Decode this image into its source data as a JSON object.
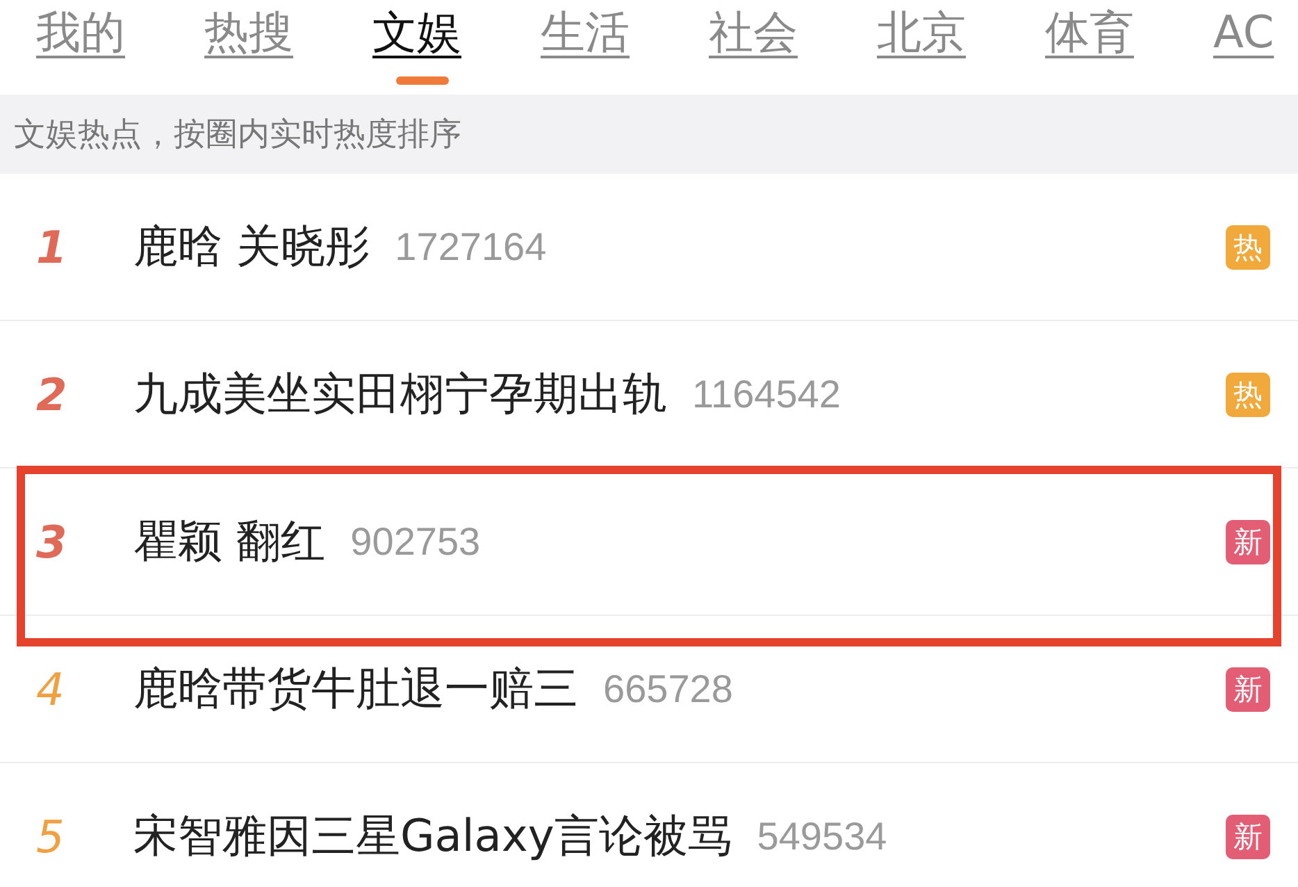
{
  "tabs": [
    {
      "label": "我的",
      "selected": false
    },
    {
      "label": "热搜",
      "selected": false
    },
    {
      "label": "文娱",
      "selected": true
    },
    {
      "label": "生活",
      "selected": false
    },
    {
      "label": "社会",
      "selected": false
    },
    {
      "label": "北京",
      "selected": false
    },
    {
      "label": "体育",
      "selected": false
    },
    {
      "label": "AC",
      "selected": false
    }
  ],
  "subtitle": "文娱热点，按圈内实时热度排序",
  "items": [
    {
      "rank": "1",
      "title": "鹿晗 关晓彤",
      "heat": "1727164",
      "badge": {
        "kind": "hot",
        "label": "热"
      },
      "highlighted": false
    },
    {
      "rank": "2",
      "title": "九成美坐实田栩宁孕期出轨",
      "heat": "1164542",
      "badge": {
        "kind": "hot",
        "label": "热"
      },
      "highlighted": false
    },
    {
      "rank": "3",
      "title": "瞿颖 翻红",
      "heat": "902753",
      "badge": {
        "kind": "new",
        "label": "新"
      },
      "highlighted": true
    },
    {
      "rank": "4",
      "title": "鹿晗带货牛肚退一赔三",
      "heat": "665728",
      "badge": {
        "kind": "new",
        "label": "新"
      },
      "highlighted": false
    },
    {
      "rank": "5",
      "title": "宋智雅因三星Galaxy言论被骂",
      "heat": "549534",
      "badge": {
        "kind": "new",
        "label": "新"
      },
      "highlighted": false
    }
  ]
}
